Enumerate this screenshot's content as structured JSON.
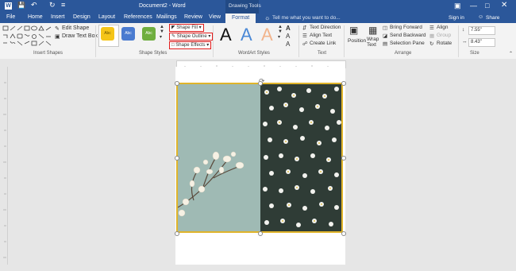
{
  "title_bar": {
    "doc_title": "Document2 - Word",
    "context": "Drawing Tools"
  },
  "tabs": [
    "File",
    "Home",
    "Insert",
    "Design",
    "Layout",
    "References",
    "Mailings",
    "Review",
    "View"
  ],
  "active_tab": "Format",
  "tell_me": "Tell me what you want to do...",
  "user": "Sign in",
  "share": "Share",
  "ribbon": {
    "insert_shapes": {
      "edit_shape": "Edit Shape",
      "draw_text_box": "Draw Text Box",
      "label": "Insert Shapes"
    },
    "shape_styles": {
      "swatch_text": "Abc",
      "shape_fill": "Shape Fill",
      "shape_outline": "Shape Outline",
      "shape_effects": "Shape Effects",
      "label": "Shape Styles"
    },
    "wordart": {
      "letter": "A",
      "label": "WordArt Styles"
    },
    "text": {
      "text_direction": "Text Direction",
      "align_text": "Align Text",
      "create_link": "Create Link",
      "label": "Text"
    },
    "arrange": {
      "position": "Position",
      "wrap_text": "Wrap Text",
      "bring_forward": "Bring Forward",
      "send_backward": "Send Backward",
      "selection_pane": "Selection Pane",
      "align": "Align",
      "group": "Group",
      "rotate": "Rotate",
      "label": "Arrange"
    },
    "size": {
      "height": "7.55\"",
      "width": "8.43\"",
      "label": "Size"
    }
  },
  "colors": {
    "brand": "#2b579a",
    "highlight": "#e21b1b",
    "selection": "#e0b42a",
    "swatch1": "#f5c518",
    "swatch2": "#4a7bd0",
    "swatch3": "#6fae3f"
  }
}
